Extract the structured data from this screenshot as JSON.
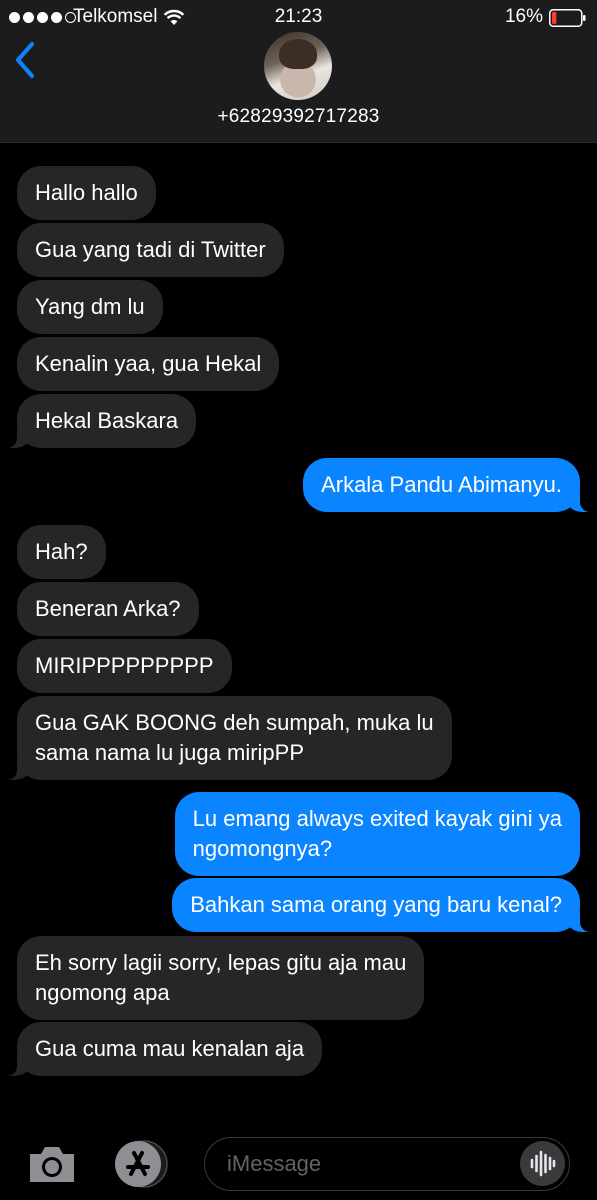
{
  "status_bar": {
    "carrier": "Telkomsel",
    "time": "21:23",
    "battery_percent": "16%",
    "battery_level": 0.16,
    "battery_color": "#ff3b30",
    "signal_bars_filled": 4,
    "signal_bars_total": 5
  },
  "contact": {
    "phone": "+62829392717283",
    "back_icon": "chevron-left-icon",
    "accent_color": "#0a84ff"
  },
  "messages": [
    {
      "dir": "in",
      "text": "Hallo hallo"
    },
    {
      "dir": "in",
      "text": "Gua yang tadi di Twitter"
    },
    {
      "dir": "in",
      "text": "Yang dm lu"
    },
    {
      "dir": "in",
      "text": "Kenalin yaa, gua Hekal"
    },
    {
      "dir": "in",
      "text": "Hekal Baskara"
    },
    {
      "dir": "out",
      "text": "Arkala Pandu Abimanyu."
    },
    {
      "dir": "in",
      "text": "Hah?"
    },
    {
      "dir": "in",
      "text": "Beneran Arka?"
    },
    {
      "dir": "in",
      "text": "MIRIPPPPPPPPP"
    },
    {
      "dir": "in",
      "line1": "Gua GAK BOONG deh sumpah, muka lu",
      "line2": "sama nama lu juga miripPP"
    },
    {
      "dir": "out",
      "line1": "Lu emang always exited kayak gini ya",
      "line2": "ngomongnya?"
    },
    {
      "dir": "out",
      "text": "Bahkan sama orang yang baru kenal?"
    },
    {
      "dir": "in",
      "line1": "Eh sorry lagii sorry, lepas gitu aja mau",
      "line2": "ngomong apa"
    },
    {
      "dir": "in",
      "text": "Gua cuma mau kenalan aja"
    }
  ],
  "input_bar": {
    "placeholder": "iMessage",
    "camera_icon": "camera-icon",
    "apps_icon": "app-store-icon",
    "audio_icon": "audio-waveform-icon"
  }
}
